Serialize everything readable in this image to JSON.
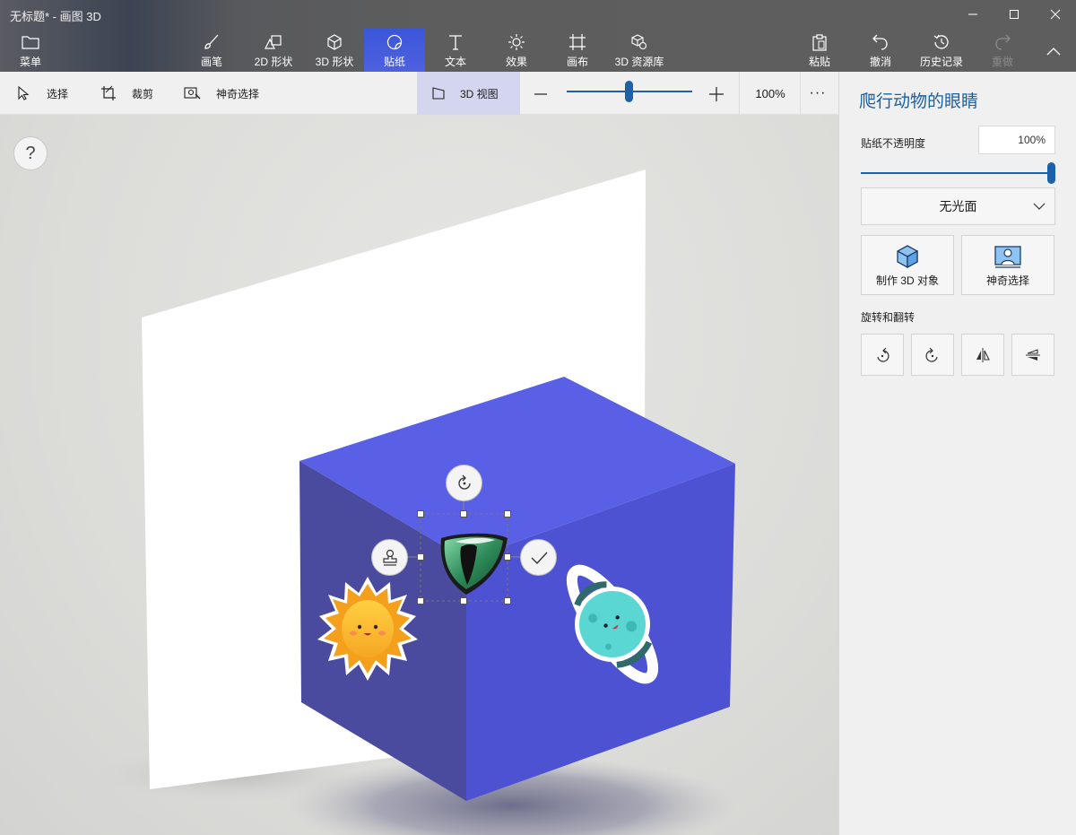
{
  "window": {
    "title": "无标题* - 画图 3D"
  },
  "header": {
    "menu_label": "菜单",
    "tabs": [
      {
        "label": "画笔",
        "icon": "brush-icon"
      },
      {
        "label": "2D 形状",
        "icon": "2d-shapes-icon"
      },
      {
        "label": "3D 形状",
        "icon": "3d-shapes-icon"
      },
      {
        "label": "贴纸",
        "icon": "stickers-icon",
        "active": true
      },
      {
        "label": "文本",
        "icon": "text-icon"
      },
      {
        "label": "效果",
        "icon": "effects-icon"
      },
      {
        "label": "画布",
        "icon": "canvas-icon"
      },
      {
        "label": "3D 资源库",
        "icon": "3d-library-icon"
      }
    ],
    "actions": {
      "paste": "粘贴",
      "undo": "撤消",
      "history": "历史记录",
      "redo": "重做"
    }
  },
  "toolbar": {
    "select": "选择",
    "crop": "裁剪",
    "magic_select": "神奇选择",
    "view_3d": "3D 视图",
    "zoom": "100%",
    "more": "···"
  },
  "canvas": {
    "help": "?"
  },
  "panel": {
    "title": "爬行动物的眼睛",
    "opacity_label": "贴纸不透明度",
    "opacity_value": "100%",
    "opacity_level": 1.0,
    "finish_dropdown": "无光面",
    "make_3d": "制作 3D 对象",
    "magic_select": "神奇选择",
    "rotate_flip_label": "旋转和翻转"
  },
  "colors": {
    "accent": "#1b62a8",
    "active_tab": "#4458dd",
    "cube_top": "#5a60e6",
    "cube_left": "#4a4a9e",
    "cube_right": "#4c52d2"
  }
}
